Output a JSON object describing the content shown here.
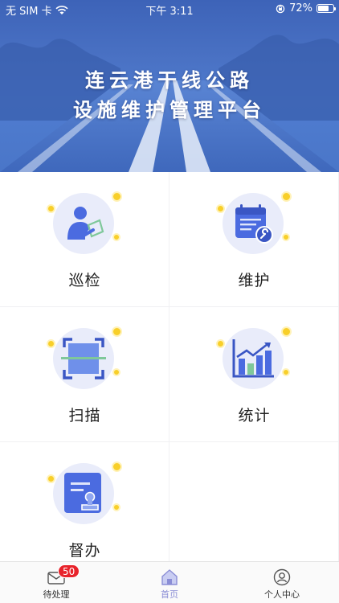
{
  "status_bar": {
    "carrier": "无 SIM 卡",
    "time": "下午 3:11",
    "battery_percent": "72%",
    "battery_level": 0.72
  },
  "hero": {
    "title_line1": "连云港干线公路",
    "title_line2": "设施维护管理平台"
  },
  "menu": [
    {
      "label": "巡检",
      "icon": "inspector-icon"
    },
    {
      "label": "维护",
      "icon": "calendar-wrench-icon"
    },
    {
      "label": "扫描",
      "icon": "scan-icon"
    },
    {
      "label": "统计",
      "icon": "bar-chart-icon"
    },
    {
      "label": "督办",
      "icon": "document-stamp-icon"
    }
  ],
  "tabbar": {
    "items": [
      {
        "label": "待处理",
        "icon": "inbox-icon",
        "badge": "50"
      },
      {
        "label": "首页",
        "icon": "home-icon"
      },
      {
        "label": "个人中心",
        "icon": "user-icon"
      }
    ],
    "active_index": 1
  },
  "colors": {
    "hero_blue": "#4a72c4",
    "icon_blue": "#4b6be0",
    "accent_yellow": "#f8cf2a",
    "badge_red": "#e8232b",
    "active_tab": "#8b8ed6"
  }
}
